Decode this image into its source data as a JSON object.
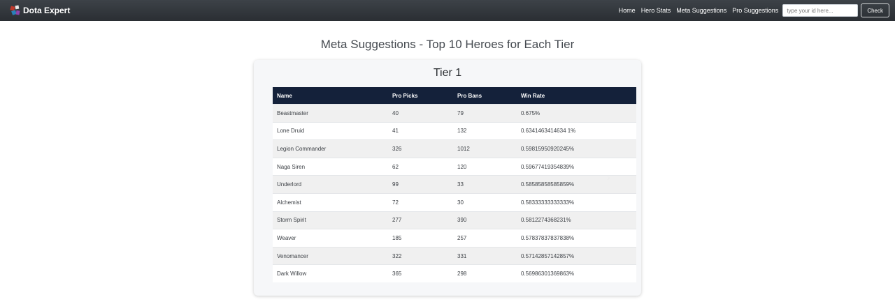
{
  "nav": {
    "brand": "Dota Expert",
    "links": [
      "Home",
      "Hero Stats",
      "Meta Suggestions",
      "Pro Suggestions"
    ],
    "search_placeholder": "type your id here...",
    "check_label": "Check"
  },
  "main": {
    "title": "Meta Suggestions - Top 10 Heroes for Each Tier",
    "tier_title": "Tier 1",
    "table": {
      "headers": [
        "Name",
        "Pro Picks",
        "Pro Bans",
        "Win Rate"
      ],
      "rows": [
        [
          "Beastmaster",
          "40",
          "79",
          "0.675%"
        ],
        [
          "Lone Druid",
          "41",
          "132",
          "0.6341463414634 1%"
        ],
        [
          "Legion Commander",
          "326",
          "1012",
          "0.59815950920245%"
        ],
        [
          "Naga Siren",
          "62",
          "120",
          "0.59677419354839%"
        ],
        [
          "Underlord",
          "99",
          "33",
          "0.58585858585859%"
        ],
        [
          "Alchemist",
          "72",
          "30",
          "0.58333333333333%"
        ],
        [
          "Storm Spirit",
          "277",
          "390",
          "0.5812274368231%"
        ],
        [
          "Weaver",
          "185",
          "257",
          "0.57837837837838%"
        ],
        [
          "Venomancer",
          "322",
          "331",
          "0.57142857142857%"
        ],
        [
          "Dark Willow",
          "365",
          "298",
          "0.56986301369863%"
        ]
      ]
    },
    "next_arrow": "›"
  }
}
